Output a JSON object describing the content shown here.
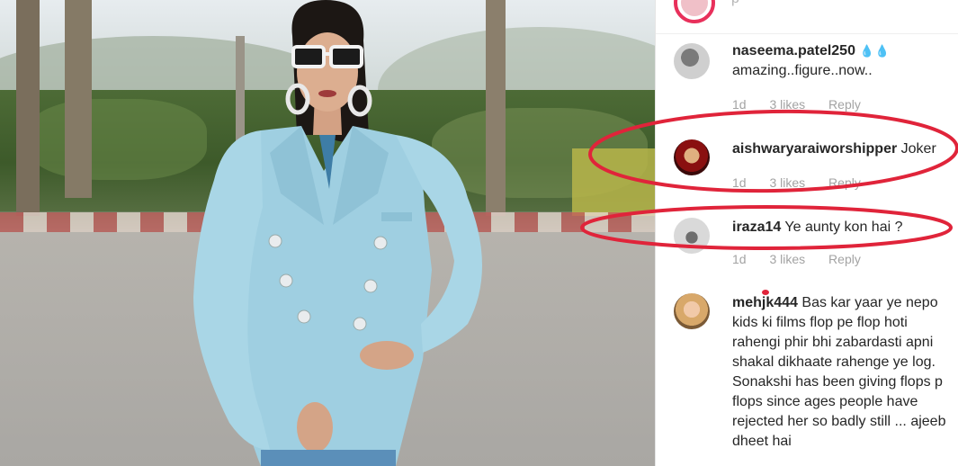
{
  "header": {
    "username": "p"
  },
  "comments": [
    {
      "username": "naseema.patel250",
      "emoji": "💧💧",
      "text": "amazing..figure..now..",
      "time": "1d",
      "likes": "3 likes",
      "reply": "Reply"
    },
    {
      "username": "aishwaryaraiworshipper",
      "text": "Joker",
      "time": "1d",
      "likes": "3 likes",
      "reply": "Reply"
    },
    {
      "username": "iraza14",
      "text": "Ye aunty kon hai ?",
      "time": "1d",
      "likes": "3 likes",
      "reply": "Reply"
    },
    {
      "username": "mehjk444",
      "text": "Bas kar yaar ye nepo kids ki films flop pe flop hoti rahengi phir bhi zabardasti apni shakal dikhaate rahenge ye log. Sonakshi has been giving flops p flops since ages people have rejected her so badly still ... ajeeb dheet hai"
    }
  ],
  "colors": {
    "annotation": "#e0243a",
    "story_ring": "#e8305b",
    "meta_text": "#a3a3a3"
  }
}
